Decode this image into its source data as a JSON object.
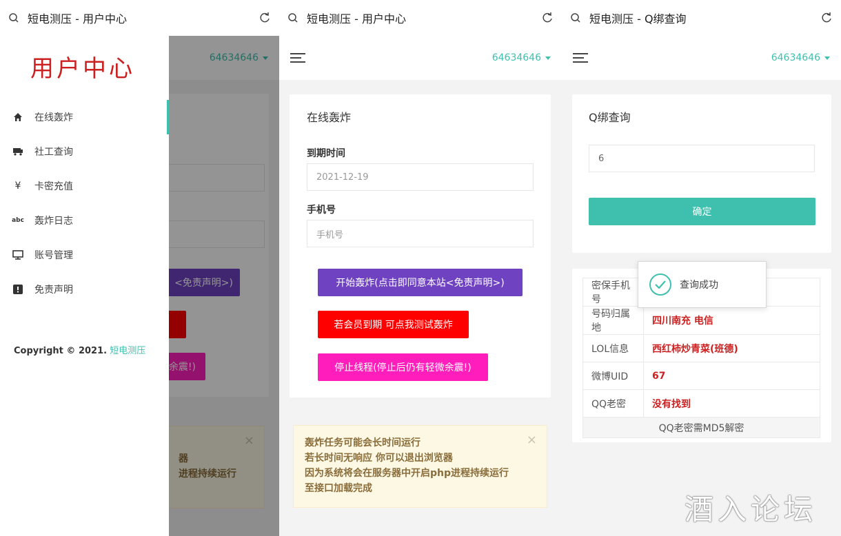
{
  "panel1": {
    "browser_title": "短电测压 - 用户中心",
    "username": "64634646",
    "brand": "用户中心",
    "menu": [
      {
        "label": "在线轰炸",
        "icon": "home-icon"
      },
      {
        "label": "社工查询",
        "icon": "car-icon"
      },
      {
        "label": "卡密充值",
        "icon": "yen-icon"
      },
      {
        "label": "轰炸日志",
        "icon": "abc-icon"
      },
      {
        "label": "账号管理",
        "icon": "monitor-icon"
      },
      {
        "label": "免责声明",
        "icon": "exclamation-icon"
      }
    ],
    "copyright_prefix": "Copyright © 2021.",
    "copyright_link": "短电测压",
    "bg_fragments": {
      "btn1": "<免责声明>)",
      "btn2": "炸",
      "btn3": "余震!)",
      "alert1": "器",
      "alert2": "进程持续运行",
      "close": "×"
    }
  },
  "panel2": {
    "browser_title": "短电测压 - 用户中心",
    "username": "64634646",
    "card_title": "在线轰炸",
    "expire_label": "到期时间",
    "expire_value": "2021-12-19",
    "phone_label": "手机号",
    "phone_placeholder": "手机号",
    "btn_start": "开始轰炸(点击即同意本站<免责声明>)",
    "btn_test": "若会员到期 可点我测试轰炸",
    "btn_stop": "停止线程(停止后仍有轻微余震!)",
    "alert_lines": [
      "轰炸任务可能会长时间运行",
      "若长时间无响应 你可以退出浏览器",
      "因为系统将会在服务器中开启php进程持续运行",
      "至接口加载完成"
    ],
    "alert_close": "×"
  },
  "panel3": {
    "browser_title": "短电测压 - Q绑查询",
    "username": "64634646",
    "card_title": "Q绑查询",
    "query_value": "6",
    "btn_confirm": "确定",
    "toast": "查询成功",
    "rows": [
      {
        "key": "密保手机号",
        "value": ""
      },
      {
        "key": "号码归属地",
        "value": "四川南充 电信"
      },
      {
        "key": "LOL信息",
        "value": "西红柿炒青菜(班德)"
      },
      {
        "key": "微博UID",
        "value": "67"
      },
      {
        "key": "QQ老密",
        "value": "没有找到"
      }
    ],
    "footer": "QQ老密需MD5解密",
    "watermark": "酒入论坛"
  },
  "colors": {
    "accent": "#3fbfae",
    "purple": "#6f42c1",
    "red": "#ff0000",
    "pink": "#ff1ebc",
    "brand_red": "#cc1f1f"
  }
}
